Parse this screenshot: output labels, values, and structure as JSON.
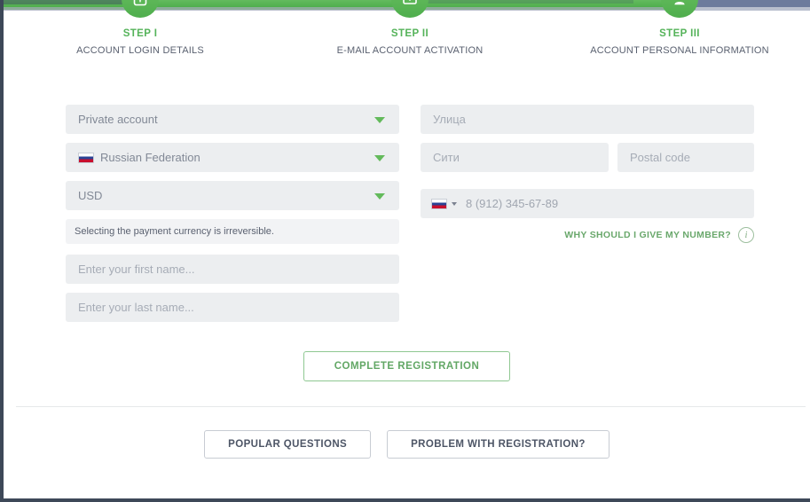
{
  "progress": {
    "completed_percent": 85,
    "fill_color": "#5cb85c",
    "track_color": "#6d7b9c"
  },
  "steps": [
    {
      "icon": "id-card-icon",
      "title": "STEP I",
      "subtitle": "ACCOUNT LOGIN DETAILS"
    },
    {
      "icon": "envelope-icon",
      "title": "STEP II",
      "subtitle": "E-MAIL ACCOUNT ACTIVATION"
    },
    {
      "icon": "user-icon",
      "title": "STEP III",
      "subtitle": "ACCOUNT PERSONAL INFORMATION"
    }
  ],
  "form": {
    "account_type": {
      "value": "Private account",
      "caret_icon": "chevron-down-icon"
    },
    "country": {
      "value": "Russian Federation",
      "flag_icon": "russia-flag-icon",
      "caret_icon": "chevron-down-icon"
    },
    "currency": {
      "value": "USD",
      "caret_icon": "chevron-down-icon"
    },
    "currency_note": "Selecting the payment currency is irreversible.",
    "first_name": {
      "value": "",
      "placeholder": "Enter your first name..."
    },
    "last_name": {
      "value": "",
      "placeholder": "Enter your last name..."
    },
    "street": {
      "value": "",
      "placeholder": "Улица"
    },
    "city": {
      "value": "",
      "placeholder": "Сити"
    },
    "postal_code": {
      "value": "",
      "placeholder": "Postal code"
    },
    "phone": {
      "flag_icon": "russia-flag-icon",
      "caret_icon": "chevron-down-icon",
      "placeholder": "8 (912) 345-67-89",
      "value": ""
    },
    "why_number": {
      "label": "WHY SHOULD I GIVE MY NUMBER?",
      "icon": "info-icon",
      "icon_glyph": "i"
    }
  },
  "actions": {
    "submit": "COMPLETE REGISTRATION"
  },
  "footer": {
    "popular_questions": "POPULAR QUESTIONS",
    "problem_with_registration": "PROBLEM WITH REGISTRATION?"
  },
  "colors": {
    "accent_green": "#5cb85c",
    "step_title_green": "#55b35a",
    "field_bg": "#eceef0",
    "border_dark": "#3d4858"
  }
}
